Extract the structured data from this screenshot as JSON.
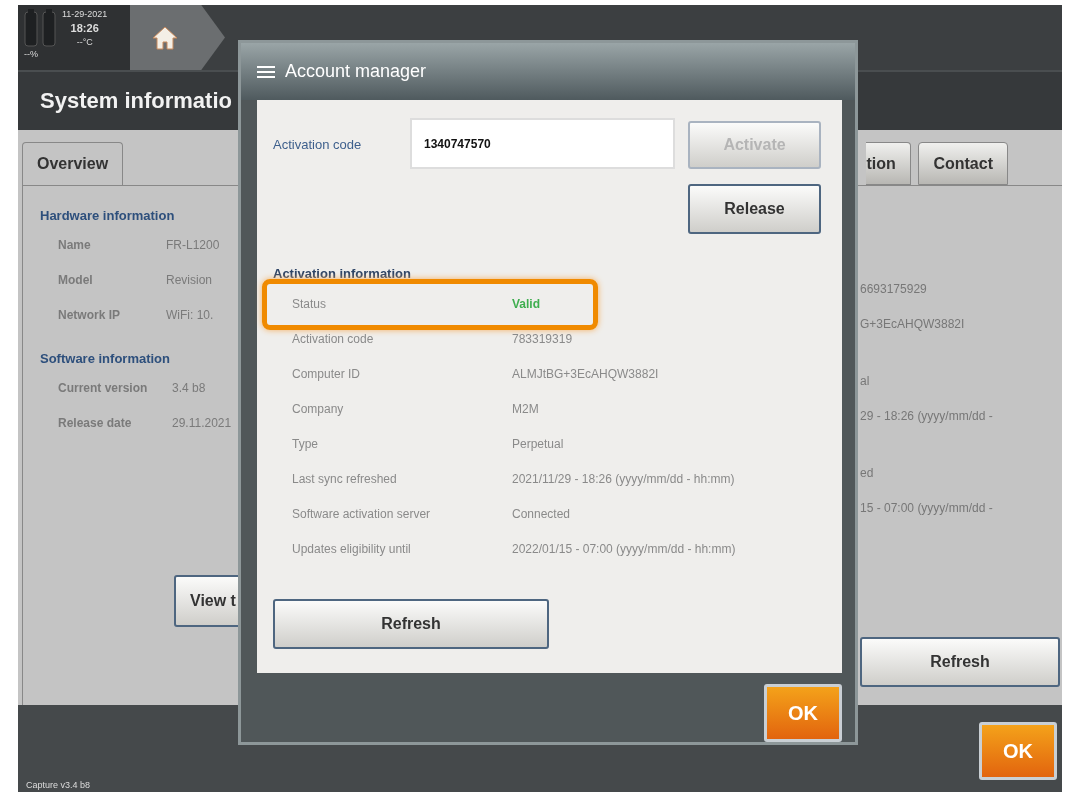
{
  "status_bar": {
    "date": "11-29-2021",
    "time": "18:26",
    "humidity": "--%",
    "temperature": "--°C"
  },
  "screen_title": "System informatio",
  "tabs": [
    {
      "label": "Overview",
      "selected": true
    },
    {
      "label": "tion",
      "selected": false
    },
    {
      "label": "Contact",
      "selected": false
    }
  ],
  "sections": [
    {
      "heading": "Hardware information",
      "rows": [
        {
          "label": "Name",
          "value": "FR-L1200"
        },
        {
          "label": "Model",
          "value": "Revision"
        },
        {
          "label": "Network IP",
          "value": "WiFi: 10."
        }
      ]
    },
    {
      "heading": "Software information",
      "rows": [
        {
          "label": "Current version",
          "value": "3.4 b8"
        },
        {
          "label": "Release date",
          "value": "29.11.2021"
        }
      ]
    }
  ],
  "view_button": "View t",
  "right_values": [
    [
      "6693175929",
      "G+3EcAHQW3882I"
    ],
    [
      "al",
      "29 - 18:26 (yyyy/mm/dd -"
    ],
    [
      "ed",
      "15 - 07:00 (yyyy/mm/dd -"
    ]
  ],
  "refresh_button": "Refresh",
  "ok_button": "OK",
  "footer_caption": "Capture v3.4 b8",
  "dialog": {
    "title": "Account manager",
    "code_label": "Activation code",
    "code_value": "1340747570",
    "buttons": [
      {
        "label": "Activate",
        "disabled": true
      },
      {
        "label": "Release",
        "disabled": false
      }
    ],
    "info_heading": "Activation information",
    "rows": [
      {
        "label": "Status",
        "value": "Valid",
        "kind": "status",
        "highlighted": true
      },
      {
        "label": "Activation code",
        "value": "783319319",
        "kind": "plain",
        "highlighted": false
      },
      {
        "label": "Computer ID",
        "value": "ALMJtBG+3EcAHQW3882I",
        "kind": "plain",
        "highlighted": false
      },
      {
        "label": "Company",
        "value": "M2M",
        "kind": "plain",
        "highlighted": false
      },
      {
        "label": "Type",
        "value": "Perpetual",
        "kind": "plain",
        "highlighted": false
      },
      {
        "label": "Last sync refreshed",
        "value": "2021/11/29 - 18:26 (yyyy/mm/dd - hh:mm)",
        "kind": "plain",
        "highlighted": false
      },
      {
        "label": "Software activation server",
        "value": "Connected",
        "kind": "plain",
        "highlighted": false
      },
      {
        "label": "Updates eligibility until",
        "value": "2022/01/15 - 07:00 (yyyy/mm/dd - hh:mm)",
        "kind": "plain",
        "highlighted": false
      }
    ],
    "refresh_button": "Refresh",
    "ok_button": "OK"
  }
}
